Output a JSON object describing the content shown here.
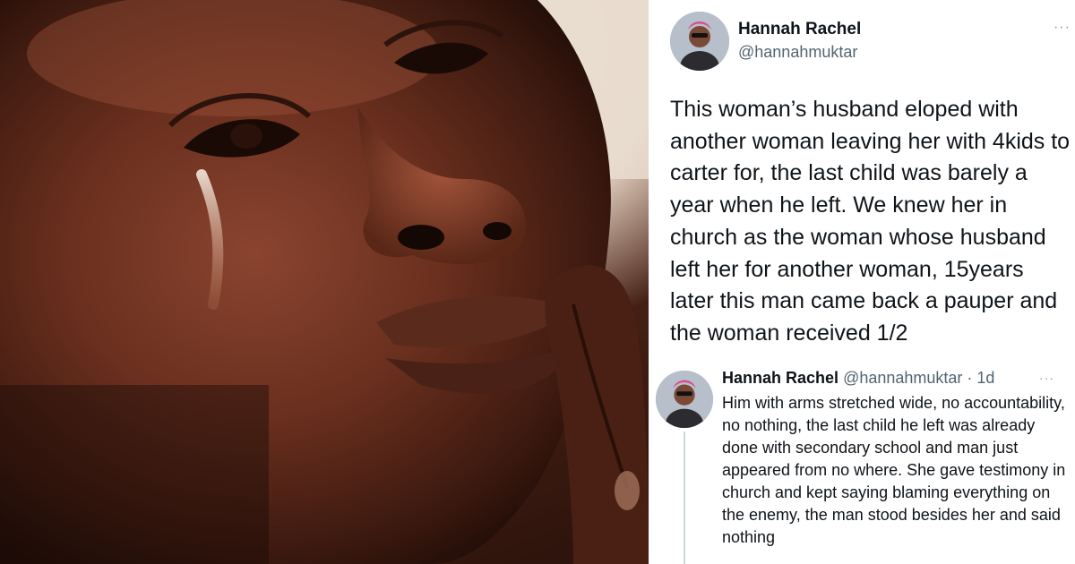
{
  "tweet": {
    "author_name": "Hannah Rachel",
    "author_handle": "@hannahmuktar",
    "more_icon": "more-dots-icon",
    "more_glyph": "···",
    "text": "This woman’s husband eloped with another woman leaving her with 4kids to carter for, the last child was barely a year when he left. We knew her in church as the woman whose husband left her for another woman, 15years later this man came back a pauper and the woman received 1/2"
  },
  "reply": {
    "author_name": "Hannah Rachel",
    "author_handle": "@hannahmuktar",
    "separator": " · ",
    "time": "1d",
    "more_glyph": "···",
    "text": "Him with arms stretched wide, no accountability, no nothing, the last child he left was already done with secondary school and man just appeared from no where. She gave testimony in church and kept saying blaming everything on the enemy, the man stood besides her and said nothing"
  },
  "colors": {
    "text_primary": "#0f1419",
    "text_secondary": "#536471",
    "thread_line": "#cfd9de"
  }
}
